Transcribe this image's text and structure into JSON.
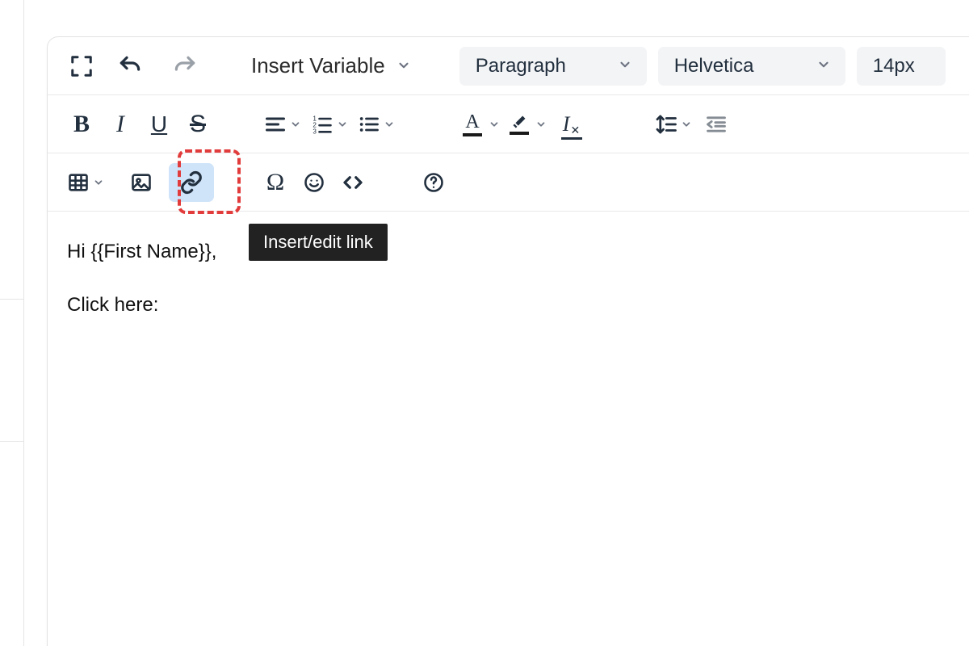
{
  "toolbar": {
    "insert_variable_label": "Insert Variable",
    "block_format": "Paragraph",
    "font_family": "Helvetica",
    "font_size": "14px",
    "tooltip_link": "Insert/edit link"
  },
  "content": {
    "line1": "Hi {{First Name}},",
    "line2": "Click here:"
  },
  "colors": {
    "icon": "#222f3e",
    "accent_underline": "#1a1a1a",
    "highlight_bg": "#cfe4f9",
    "highlight_border": "#e23b3b",
    "tooltip_bg": "#222222"
  }
}
